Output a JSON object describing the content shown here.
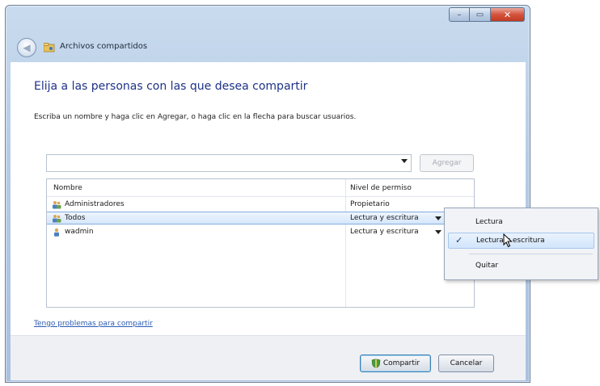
{
  "window": {
    "title": "Archivos compartidos",
    "controls": {
      "minimize": "–",
      "maximize": "▭",
      "close": "✕"
    }
  },
  "heading": "Elija a las personas con las que desea compartir",
  "instruction": "Escriba un nombre y haga clic en Agregar, o haga clic en la flecha para buscar usuarios.",
  "input": {
    "value": "",
    "placeholder": ""
  },
  "add_button": "Agregar",
  "list": {
    "columns": [
      "Nombre",
      "Nivel de permiso"
    ],
    "rows": [
      {
        "name": "Administradores",
        "permission": "Propietario",
        "icon": "group-icon",
        "selected": false,
        "has_dropdown": false
      },
      {
        "name": "Todos",
        "permission": "Lectura y escritura",
        "icon": "group-icon",
        "selected": true,
        "has_dropdown": true
      },
      {
        "name": "wadmin",
        "permission": "Lectura y escritura",
        "icon": "user-icon",
        "selected": false,
        "has_dropdown": true
      }
    ]
  },
  "help_link": "Tengo problemas para compartir",
  "buttons": {
    "share": "Compartir",
    "cancel": "Cancelar"
  },
  "context_menu": {
    "items": [
      {
        "label": "Lectura",
        "checked": false
      },
      {
        "label": "Lectura y escritura",
        "checked": true
      },
      {
        "label": "Quitar",
        "checked": false
      }
    ]
  }
}
